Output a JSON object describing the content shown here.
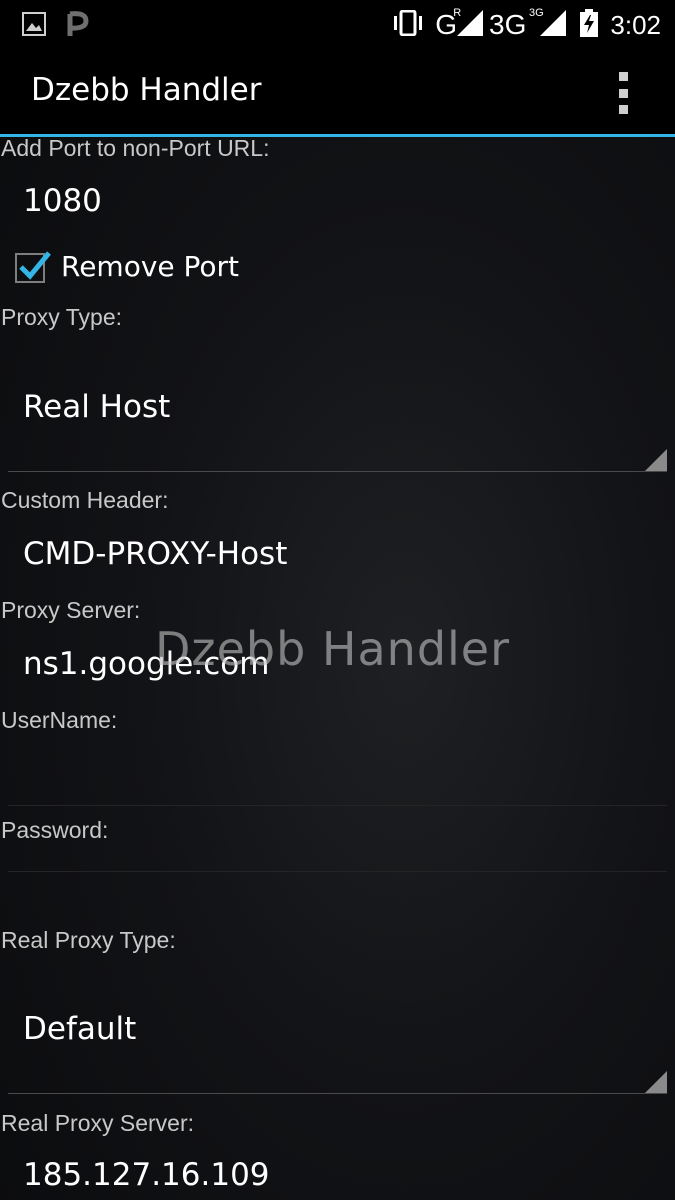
{
  "status_bar": {
    "icons": [
      "image-notification-icon",
      "p-notification-icon",
      "vibrate-icon",
      "signal-icon",
      "battery-charging-icon"
    ],
    "network_1": "G",
    "network_1_sup": "R",
    "network_2": "3G",
    "network_2_sup": "3G",
    "time": "3:02"
  },
  "action_bar": {
    "title": "Dzebb Handler",
    "accent_color": "#33b5e5"
  },
  "form": {
    "add_port_label": "Add Port to non-Port URL:",
    "add_port_value": "1080",
    "remove_port_label": "Remove Port",
    "remove_port_checked": true,
    "proxy_type_label": "Proxy Type:",
    "proxy_type_value": "Real Host",
    "custom_header_label": "Custom Header:",
    "custom_header_value": "CMD-PROXY-Host",
    "proxy_server_label": "Proxy Server:",
    "proxy_server_value": "ns1.google.com",
    "username_label": "UserName:",
    "username_value": "",
    "password_label": "Password:",
    "password_value": "",
    "real_proxy_type_label": "Real Proxy Type:",
    "real_proxy_type_value": "Default",
    "real_proxy_server_label": "Real Proxy Server:",
    "real_proxy_server_value": "185.127.16.109"
  },
  "watermark": "Dzebb Handler"
}
